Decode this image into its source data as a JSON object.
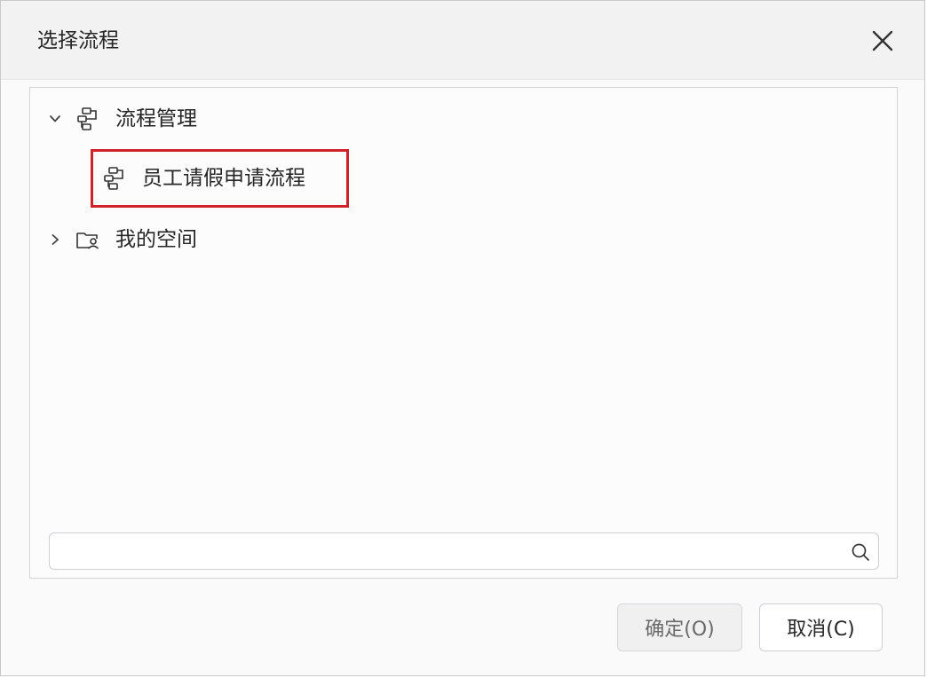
{
  "dialog": {
    "title": "选择流程",
    "close_icon": "close-x-icon"
  },
  "tree": {
    "nodes": [
      {
        "label": "流程管理",
        "expanded": true,
        "chevron_icon": "chevron-down-icon",
        "icon": "process-flow-icon"
      },
      {
        "label": "员工请假申请流程",
        "selected": true,
        "icon": "process-flow-icon"
      },
      {
        "label": "我的空间",
        "expanded": false,
        "chevron_icon": "chevron-right-icon",
        "icon": "user-folder-icon"
      }
    ]
  },
  "search": {
    "value": "",
    "placeholder": "",
    "icon": "search-icon"
  },
  "buttons": {
    "ok_label": "确定(O)",
    "cancel_label": "取消(C)"
  },
  "colors": {
    "selection_highlight": "#d0202a",
    "header_bg": "#f2f2f2",
    "panel_border": "#d4d4d8"
  }
}
